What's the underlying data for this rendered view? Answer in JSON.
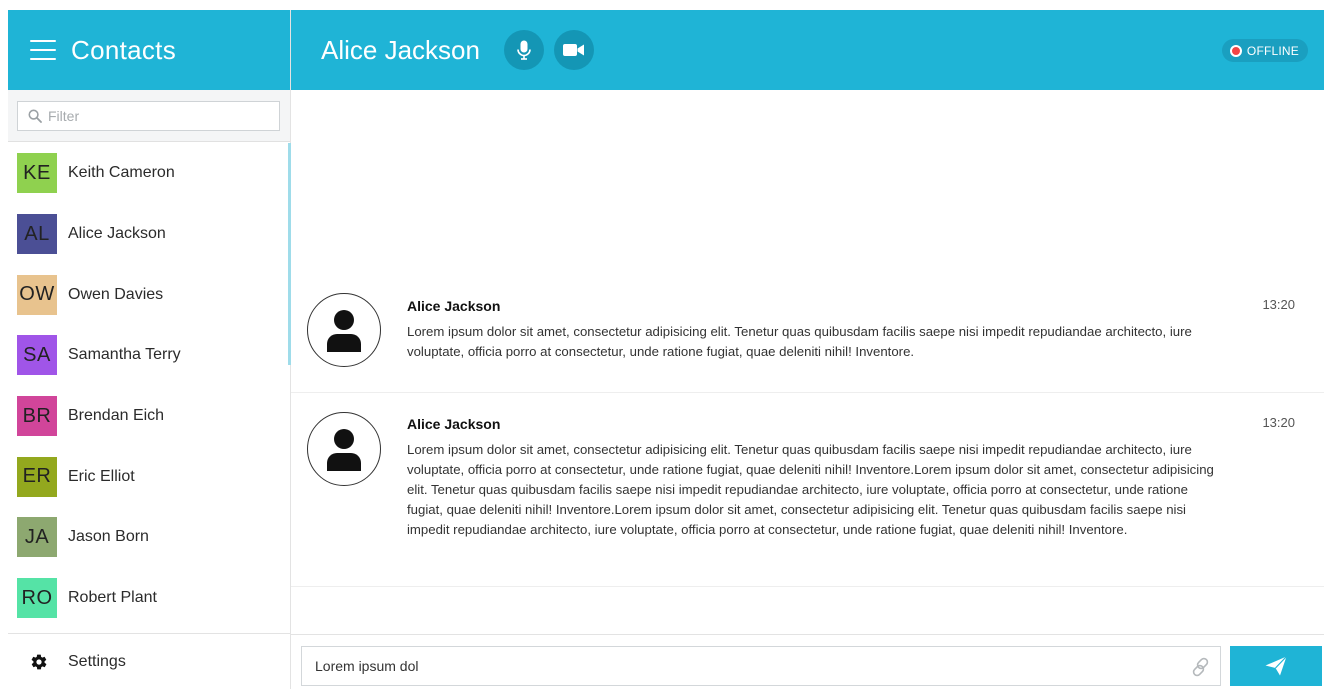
{
  "sidebar": {
    "title": "Contacts",
    "filter_placeholder": "Filter",
    "contacts": [
      {
        "initials": "KE",
        "name": "Keith Cameron",
        "color": "#8fd14f"
      },
      {
        "initials": "AL",
        "name": "Alice Jackson",
        "color": "#4b4f95"
      },
      {
        "initials": "OW",
        "name": "Owen Davies",
        "color": "#e8c38e"
      },
      {
        "initials": "SA",
        "name": "Samantha Terry",
        "color": "#a055e8"
      },
      {
        "initials": "BR",
        "name": "Brendan Eich",
        "color": "#d1459a"
      },
      {
        "initials": "ER",
        "name": "Eric Elliot",
        "color": "#93a81e"
      },
      {
        "initials": "JA",
        "name": "Jason Born",
        "color": "#8da870"
      },
      {
        "initials": "RO",
        "name": "Robert Plant",
        "color": "#55e3a6"
      }
    ],
    "settings_label": "Settings"
  },
  "header": {
    "title": "Alice Jackson",
    "status": "OFFLINE",
    "accent_color": "#1fb4d6"
  },
  "messages": [
    {
      "author": "Alice Jackson",
      "time": "13:20",
      "text": "Lorem ipsum dolor sit amet, consectetur adipisicing elit. Tenetur quas quibusdam facilis saepe nisi impedit repudiandae architecto, iure voluptate, officia porro at consectetur, unde ratione fugiat, quae deleniti nihil! Inventore."
    },
    {
      "author": "Alice Jackson",
      "time": "13:20",
      "text": "Lorem ipsum dolor sit amet, consectetur adipisicing elit. Tenetur quas quibusdam facilis saepe nisi impedit repudiandae architecto, iure voluptate, officia porro at consectetur, unde ratione fugiat, quae deleniti nihil! Inventore.Lorem ipsum dolor sit amet, consectetur adipisicing elit. Tenetur quas quibusdam facilis saepe nisi impedit repudiandae architecto, iure voluptate, officia porro at consectetur, unde ratione fugiat, quae deleniti nihil! Inventore.Lorem ipsum dolor sit amet, consectetur adipisicing elit. Tenetur quas quibusdam facilis saepe nisi impedit repudiandae architecto, iure voluptate, officia porro at consectetur, unde ratione fugiat, quae deleniti nihil! Inventore."
    }
  ],
  "composer": {
    "value": "Lorem ipsum dol"
  },
  "icons": {
    "menu": "hamburger-icon",
    "filter": "search-icon",
    "mic": "microphone-icon",
    "video": "video-camera-icon",
    "settings": "gear-icon",
    "attach": "link-icon",
    "send": "paper-plane-icon"
  }
}
